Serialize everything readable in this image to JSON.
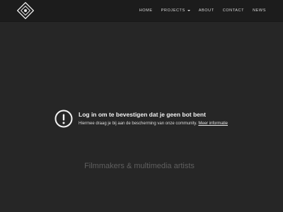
{
  "nav": {
    "items": [
      {
        "label": "HOME"
      },
      {
        "label": "PROJECTS"
      },
      {
        "label": "ABOUT"
      },
      {
        "label": "CONTACT"
      },
      {
        "label": "NEWS"
      }
    ]
  },
  "notice": {
    "icon": "exclamation-circle-icon",
    "title": "Log in om te bevestigen dat je geen bot bent",
    "text": "Hiermee draag je bij aan de bescherming van onze community.",
    "link": "Meer informatie"
  },
  "hero": {
    "tagline": "Filmmakers & multimedia artists"
  },
  "colors": {
    "background": "#262626",
    "navbar": "#1c1c1c",
    "tagline": "#5f5f5f"
  }
}
